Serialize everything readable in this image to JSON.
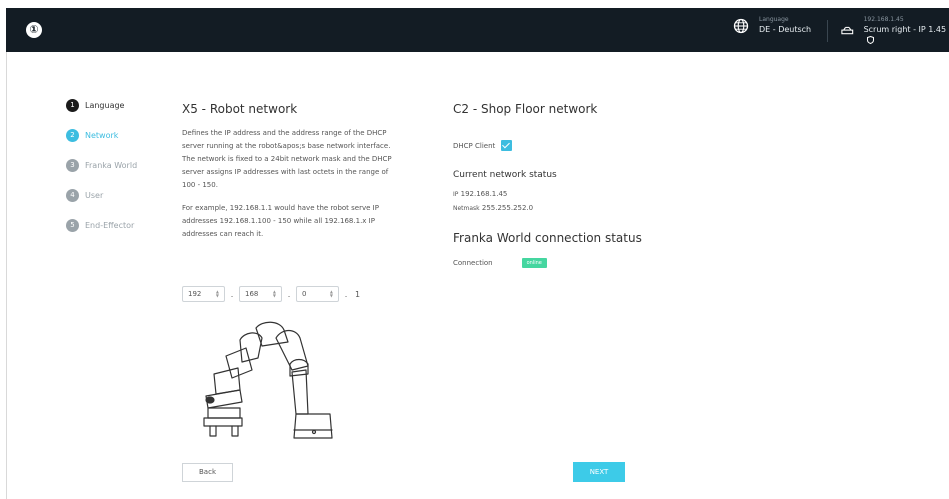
{
  "header": {
    "logo_glyph": "①",
    "language_caption": "Language",
    "language_value": "DE - Deutsch",
    "robot_ip": "192.168.1.45",
    "robot_name": "Scrum right - IP 1.45"
  },
  "steps": [
    {
      "number": "1",
      "label": "Language",
      "state": "done"
    },
    {
      "number": "2",
      "label": "Network",
      "state": "active"
    },
    {
      "number": "3",
      "label": "Franka World",
      "state": "pending"
    },
    {
      "number": "4",
      "label": "User",
      "state": "pending"
    },
    {
      "number": "5",
      "label": "End-Effector",
      "state": "pending"
    }
  ],
  "robot_network": {
    "title": "X5 - Robot network",
    "description": "Defines the IP address and the address range of the DHCP server running at the robot&apos;s base network interface. The network is fixed to a 24bit network mask and the DHCP server assigns IP addresses with last octets in the range of 100 - 150.",
    "example": "For example, 192.168.1.1 would have the robot serve IP addresses 192.168.1.100 - 150 while all 192.168.1.x IP addresses can reach it.",
    "ip_octets": [
      "192",
      "168",
      "0"
    ],
    "ip_separator": ".",
    "ip_last": "1"
  },
  "shop_floor": {
    "title": "C2 - Shop Floor network",
    "dhcp_label": "DHCP Client",
    "dhcp_checked": true,
    "status_title": "Current network status",
    "ip_key": "IP",
    "ip_value": "192.168.1.45",
    "netmask_key": "Netmask",
    "netmask_value": "255.255.252.0"
  },
  "franka_world": {
    "title": "Franka World connection status",
    "connection_label": "Connection",
    "status": "online"
  },
  "buttons": {
    "back": "Back",
    "next": "NEXT"
  },
  "colors": {
    "header_bg": "#131c24",
    "accent": "#3dbde0",
    "next_button": "#3dcbe8",
    "online_badge": "#45d6a0"
  }
}
